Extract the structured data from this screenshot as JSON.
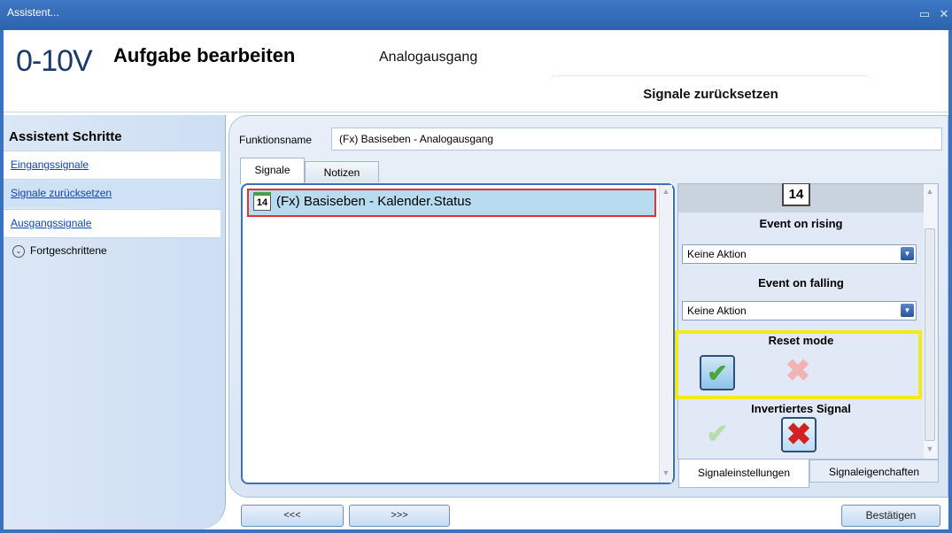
{
  "window": {
    "title": "Assistent...",
    "restore_icon": "▭",
    "close_icon": "✕"
  },
  "header": {
    "logo": "0-10V",
    "title": "Aufgabe bearbeiten",
    "subtitle": "Analogausgang",
    "section_tab": "Signale zurücksetzen"
  },
  "sidebar": {
    "title": "Assistent Schritte",
    "items": [
      {
        "label": "Eingangssignale"
      },
      {
        "label": "Signale zurücksetzen"
      },
      {
        "label": "Ausgangssignale"
      }
    ],
    "advanced_label": "Fortgeschrittene",
    "advanced_icon": "⌄"
  },
  "form": {
    "function_label": "Funktionsname",
    "function_value": "(Fx) Basiseben - Analogausgang"
  },
  "tabs": {
    "signals": "Signale",
    "notes": "Notizen"
  },
  "signal_list": {
    "items": [
      {
        "icon_number": "14",
        "label": "(Fx) Basiseben - Kalender.Status"
      }
    ]
  },
  "settings": {
    "header_icon_number": "14",
    "rising_title": "Event on rising",
    "rising_value": "Keine Aktion",
    "falling_title": "Event on falling",
    "falling_value": "Keine Aktion",
    "reset_title": "Reset mode",
    "inverted_title": "Invertiertes Signal",
    "check_glyph": "✔",
    "cross_glyph": "✖",
    "dropdown_glyph": "▼",
    "tab_settings": "Signaleinstellungen",
    "tab_properties": "Signaleigenchaften"
  },
  "buttons": {
    "prev": "<<<",
    "next": ">>>",
    "confirm": "Bestätigen"
  },
  "colors": {
    "accent": "#3b72bf",
    "highlight_red": "#e53030",
    "highlight_yellow": "#f2ea1d"
  }
}
